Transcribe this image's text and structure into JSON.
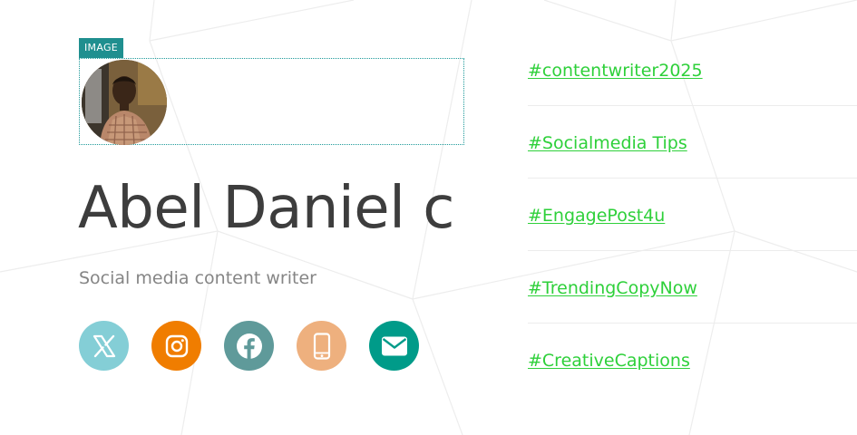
{
  "image_block": {
    "tag_label": "IMAGE"
  },
  "profile": {
    "name": "Abel Daniel c",
    "subtitle": "Social media content writer"
  },
  "socials": [
    {
      "icon": "x-twitter-icon",
      "color": "#84ced6"
    },
    {
      "icon": "instagram-icon",
      "color": "#f07d00"
    },
    {
      "icon": "facebook-icon",
      "color": "#5f9a9a"
    },
    {
      "icon": "phone-icon",
      "color": "#eeb07e"
    },
    {
      "icon": "email-icon",
      "color": "#009b89"
    }
  ],
  "hashtags": [
    "#contentwriter2025",
    "#Socialmedia Tips",
    "#EngagePost4u",
    "#TrendingCopyNow",
    "#CreativeCaptions"
  ],
  "colors": {
    "accent_teal": "#1f8f8f",
    "hashtag_green": "#2ed03a",
    "name_text": "#3d3d3d",
    "subtitle_text": "#858585"
  }
}
